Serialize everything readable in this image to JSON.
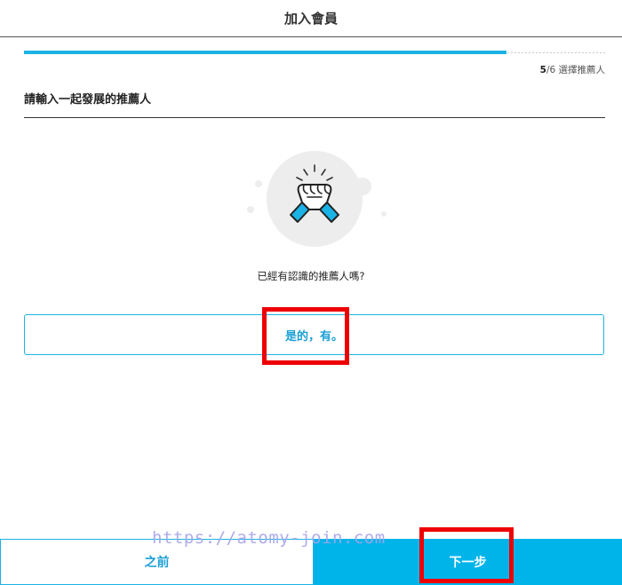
{
  "header": {
    "title": "加入會員"
  },
  "progress": {
    "fraction": 0.83,
    "current_step": "5",
    "total_step": "/6",
    "step_label": " 選擇推薦人"
  },
  "question": {
    "title": "請輸入一起發展的推薦人"
  },
  "prompt": {
    "text": "已經有認識的推薦人嗎?"
  },
  "options": {
    "yes_label": "是的，有。"
  },
  "footer": {
    "prev_label": "之前",
    "next_label": "下一步"
  },
  "watermark": {
    "text": "https://atomy-join.com"
  },
  "illustration": {
    "icon": "handshake-icon"
  },
  "colors": {
    "accent": "#1bb3e6",
    "primary_button": "#00b4ea",
    "highlight": "#ee0000"
  }
}
